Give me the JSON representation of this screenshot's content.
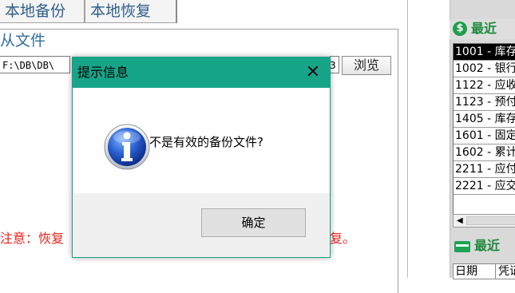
{
  "tabs": {
    "backup": "本地备份",
    "restore": "本地恢复"
  },
  "restore_panel": {
    "from_file_label": "从文件",
    "path_value": "F:\\DB\\DB\\",
    "path_tail": "3",
    "browse_label": "浏览",
    "notice_left": "注意：恢复",
    "notice_right": "复。"
  },
  "right_panel": {
    "section1_icon": "dollar-icon",
    "section1_title": "最近",
    "accounts": [
      "1001 - 库存",
      "1002 - 银行",
      "1122 - 应收",
      "1123 - 预付",
      "1405 - 库存",
      "1601 - 固定",
      "1602 - 累计",
      "2211 - 应付",
      "2221 - 应交"
    ],
    "selected_index": 0,
    "section2_icon": "card-icon",
    "section2_title": "最近",
    "grid_headers": [
      "日期",
      "凭证"
    ]
  },
  "dialog": {
    "title": "提示信息",
    "close_glyph": "✕",
    "message": "不是有效的备份文件?",
    "icon": "info-icon",
    "ok_label": "确定"
  },
  "colors": {
    "dialog_title_bg": "#17a589",
    "notice_red": "#e8231e",
    "section_green": "#1e8a3c"
  }
}
